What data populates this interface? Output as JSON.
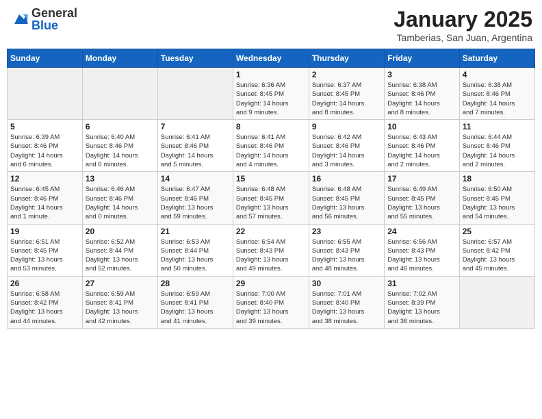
{
  "header": {
    "logo_general": "General",
    "logo_blue": "Blue",
    "title": "January 2025",
    "subtitle": "Tamberias, San Juan, Argentina"
  },
  "weekdays": [
    "Sunday",
    "Monday",
    "Tuesday",
    "Wednesday",
    "Thursday",
    "Friday",
    "Saturday"
  ],
  "weeks": [
    [
      {
        "day": "",
        "info": ""
      },
      {
        "day": "",
        "info": ""
      },
      {
        "day": "",
        "info": ""
      },
      {
        "day": "1",
        "info": "Sunrise: 6:36 AM\nSunset: 8:45 PM\nDaylight: 14 hours\nand 9 minutes."
      },
      {
        "day": "2",
        "info": "Sunrise: 6:37 AM\nSunset: 8:45 PM\nDaylight: 14 hours\nand 8 minutes."
      },
      {
        "day": "3",
        "info": "Sunrise: 6:38 AM\nSunset: 8:46 PM\nDaylight: 14 hours\nand 8 minutes."
      },
      {
        "day": "4",
        "info": "Sunrise: 6:38 AM\nSunset: 8:46 PM\nDaylight: 14 hours\nand 7 minutes."
      }
    ],
    [
      {
        "day": "5",
        "info": "Sunrise: 6:39 AM\nSunset: 8:46 PM\nDaylight: 14 hours\nand 6 minutes."
      },
      {
        "day": "6",
        "info": "Sunrise: 6:40 AM\nSunset: 8:46 PM\nDaylight: 14 hours\nand 6 minutes."
      },
      {
        "day": "7",
        "info": "Sunrise: 6:41 AM\nSunset: 8:46 PM\nDaylight: 14 hours\nand 5 minutes."
      },
      {
        "day": "8",
        "info": "Sunrise: 6:41 AM\nSunset: 8:46 PM\nDaylight: 14 hours\nand 4 minutes."
      },
      {
        "day": "9",
        "info": "Sunrise: 6:42 AM\nSunset: 8:46 PM\nDaylight: 14 hours\nand 3 minutes."
      },
      {
        "day": "10",
        "info": "Sunrise: 6:43 AM\nSunset: 8:46 PM\nDaylight: 14 hours\nand 2 minutes."
      },
      {
        "day": "11",
        "info": "Sunrise: 6:44 AM\nSunset: 8:46 PM\nDaylight: 14 hours\nand 2 minutes."
      }
    ],
    [
      {
        "day": "12",
        "info": "Sunrise: 6:45 AM\nSunset: 8:46 PM\nDaylight: 14 hours\nand 1 minute."
      },
      {
        "day": "13",
        "info": "Sunrise: 6:46 AM\nSunset: 8:46 PM\nDaylight: 14 hours\nand 0 minutes."
      },
      {
        "day": "14",
        "info": "Sunrise: 6:47 AM\nSunset: 8:46 PM\nDaylight: 13 hours\nand 59 minutes."
      },
      {
        "day": "15",
        "info": "Sunrise: 6:48 AM\nSunset: 8:45 PM\nDaylight: 13 hours\nand 57 minutes."
      },
      {
        "day": "16",
        "info": "Sunrise: 6:48 AM\nSunset: 8:45 PM\nDaylight: 13 hours\nand 56 minutes."
      },
      {
        "day": "17",
        "info": "Sunrise: 6:49 AM\nSunset: 8:45 PM\nDaylight: 13 hours\nand 55 minutes."
      },
      {
        "day": "18",
        "info": "Sunrise: 6:50 AM\nSunset: 8:45 PM\nDaylight: 13 hours\nand 54 minutes."
      }
    ],
    [
      {
        "day": "19",
        "info": "Sunrise: 6:51 AM\nSunset: 8:45 PM\nDaylight: 13 hours\nand 53 minutes."
      },
      {
        "day": "20",
        "info": "Sunrise: 6:52 AM\nSunset: 8:44 PM\nDaylight: 13 hours\nand 52 minutes."
      },
      {
        "day": "21",
        "info": "Sunrise: 6:53 AM\nSunset: 8:44 PM\nDaylight: 13 hours\nand 50 minutes."
      },
      {
        "day": "22",
        "info": "Sunrise: 6:54 AM\nSunset: 8:43 PM\nDaylight: 13 hours\nand 49 minutes."
      },
      {
        "day": "23",
        "info": "Sunrise: 6:55 AM\nSunset: 8:43 PM\nDaylight: 13 hours\nand 48 minutes."
      },
      {
        "day": "24",
        "info": "Sunrise: 6:56 AM\nSunset: 8:43 PM\nDaylight: 13 hours\nand 46 minutes."
      },
      {
        "day": "25",
        "info": "Sunrise: 6:57 AM\nSunset: 8:42 PM\nDaylight: 13 hours\nand 45 minutes."
      }
    ],
    [
      {
        "day": "26",
        "info": "Sunrise: 6:58 AM\nSunset: 8:42 PM\nDaylight: 13 hours\nand 44 minutes."
      },
      {
        "day": "27",
        "info": "Sunrise: 6:59 AM\nSunset: 8:41 PM\nDaylight: 13 hours\nand 42 minutes."
      },
      {
        "day": "28",
        "info": "Sunrise: 6:59 AM\nSunset: 8:41 PM\nDaylight: 13 hours\nand 41 minutes."
      },
      {
        "day": "29",
        "info": "Sunrise: 7:00 AM\nSunset: 8:40 PM\nDaylight: 13 hours\nand 39 minutes."
      },
      {
        "day": "30",
        "info": "Sunrise: 7:01 AM\nSunset: 8:40 PM\nDaylight: 13 hours\nand 38 minutes."
      },
      {
        "day": "31",
        "info": "Sunrise: 7:02 AM\nSunset: 8:39 PM\nDaylight: 13 hours\nand 36 minutes."
      },
      {
        "day": "",
        "info": ""
      }
    ]
  ]
}
